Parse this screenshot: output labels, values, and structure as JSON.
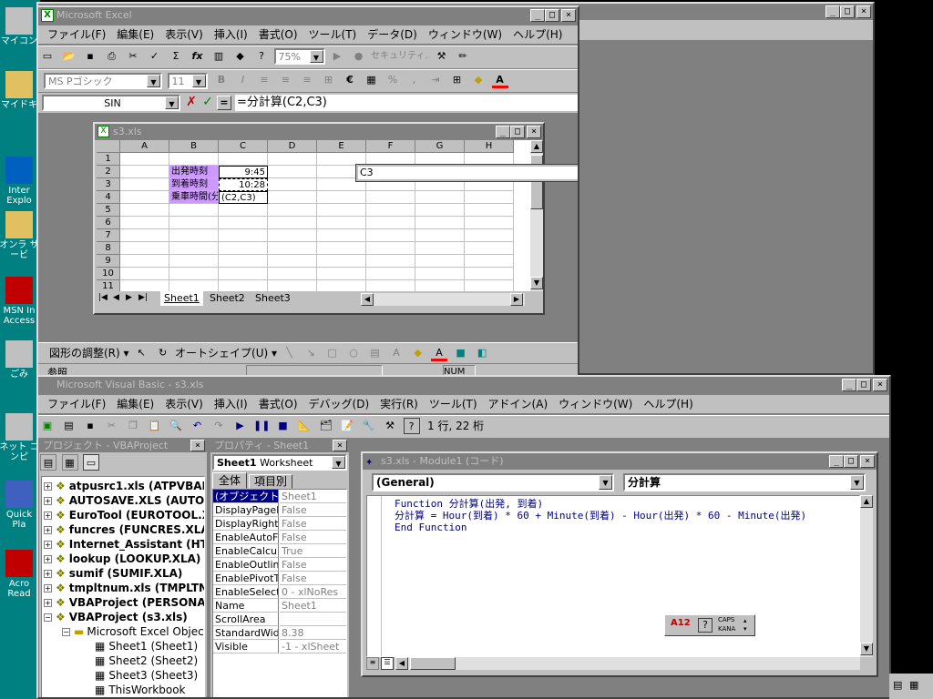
{
  "desktop": {
    "icons": [
      {
        "label": "マイコン",
        "icon": "computer-icon"
      },
      {
        "label": "マイドキ",
        "icon": "folder-icon"
      },
      {
        "label": "Inter Explo",
        "icon": "ie-icon"
      },
      {
        "label": "オンラ サービ",
        "icon": "folder-icon"
      },
      {
        "label": "MSN In Access",
        "icon": "msn-icon"
      },
      {
        "label": "ごみ",
        "icon": "recycle-bin-icon"
      },
      {
        "label": "ネット コンピ",
        "icon": "network-icon"
      },
      {
        "label": "Quick Pla",
        "icon": "quicktime-icon"
      },
      {
        "label": "Acro Read",
        "icon": "acrobat-icon"
      }
    ]
  },
  "excel": {
    "title": "Microsoft Excel",
    "menu": [
      "ファイル(F)",
      "編集(E)",
      "表示(V)",
      "挿入(I)",
      "書式(O)",
      "ツール(T)",
      "データ(D)",
      "ウィンドウ(W)",
      "ヘルプ(H)"
    ],
    "zoom": "75%",
    "security_label": "セキュリティ...",
    "font_name": "MS Pゴシック",
    "font_size": "11",
    "name_box": "SIN",
    "formula": "=分計算(C2,C3)",
    "arg_input": "C3",
    "workbook": {
      "title": "s3.xls",
      "columns": [
        "A",
        "B",
        "C",
        "D",
        "E",
        "F",
        "G",
        "H"
      ],
      "rows": [
        "1",
        "2",
        "3",
        "4",
        "5",
        "6",
        "7",
        "8",
        "9",
        "10",
        "11"
      ],
      "cells": {
        "B2": "出発時刻",
        "C2": "9:45",
        "B3": "到着時刻",
        "C3": "10:28",
        "B4": "乗車時間(分)",
        "C4": "(C2,C3)"
      },
      "sheets": [
        "Sheet1",
        "Sheet2",
        "Sheet3"
      ]
    },
    "drawing": {
      "adjust": "図形の調整(R)",
      "autoshape": "オートシェイプ(U)"
    },
    "status": {
      "mode": "参照",
      "num": "NUM"
    }
  },
  "vbe": {
    "title": "Microsoft Visual Basic - s3.xls",
    "menu": [
      "ファイル(F)",
      "編集(E)",
      "表示(V)",
      "挿入(I)",
      "書式(O)",
      "デバッグ(D)",
      "実行(R)",
      "ツール(T)",
      "アドイン(A)",
      "ウィンドウ(W)",
      "ヘルプ(H)"
    ],
    "position": "1 行, 22 桁",
    "project": {
      "title": "プロジェクト - VBAProject",
      "items": [
        {
          "label": "atpusrc1.xls (ATPVBAE",
          "bold": true
        },
        {
          "label": "AUTOSAVE.XLS (AUTO",
          "bold": true
        },
        {
          "label": "EuroTool (EUROTOOL.X",
          "bold": true
        },
        {
          "label": "funcres (FUNCRES.XLA",
          "bold": true
        },
        {
          "label": "Internet_Assistant (HTI",
          "bold": true
        },
        {
          "label": "lookup (LOOKUP.XLA)",
          "bold": true
        },
        {
          "label": "sumif (SUMIF.XLA)",
          "bold": true
        },
        {
          "label": "tmpltnum.xls (TMPLTNU",
          "bold": true
        },
        {
          "label": "VBAProject (PERSONA",
          "bold": true
        },
        {
          "label": "VBAProject (s3.xls)",
          "bold": true
        }
      ],
      "folder": "Microsoft Excel Objects",
      "children": [
        "Sheet1 (Sheet1)",
        "Sheet2 (Sheet2)",
        "Sheet3 (Sheet3)",
        "ThisWorkbook"
      ]
    },
    "properties": {
      "title": "プロパティ - Sheet1",
      "object": "Sheet1",
      "object_type": "Worksheet",
      "tabs": [
        "全体",
        "項目別"
      ],
      "rows": [
        {
          "k": "(オブジェクト名)",
          "v": "Sheet1"
        },
        {
          "k": "DisplayPageBr",
          "v": "False"
        },
        {
          "k": "DisplayRightTo",
          "v": "False"
        },
        {
          "k": "EnableAutoFilt",
          "v": "False"
        },
        {
          "k": "EnableCalcula",
          "v": "True"
        },
        {
          "k": "EnableOutlinin",
          "v": "False"
        },
        {
          "k": "EnablePivotTa",
          "v": "False"
        },
        {
          "k": "EnableSelectio",
          "v": "0 - xlNoRes"
        },
        {
          "k": "Name",
          "v": "Sheet1"
        },
        {
          "k": "ScrollArea",
          "v": ""
        },
        {
          "k": "StandardWidth",
          "v": "8.38"
        },
        {
          "k": "Visible",
          "v": "-1 - xlSheet"
        }
      ]
    },
    "module": {
      "title": "s3.xls - Module1 (コード)",
      "object_combo": "(General)",
      "proc_combo": "分計算",
      "code": [
        "Function 分計算(出発, 到着)",
        "分計算 = Hour(到着) * 60 + Minute(到着) - Hour(出発) * 60 - Minute(出発)",
        "End Function"
      ]
    },
    "ime": {
      "caps": "CAPS",
      "kana": "KANA"
    }
  }
}
